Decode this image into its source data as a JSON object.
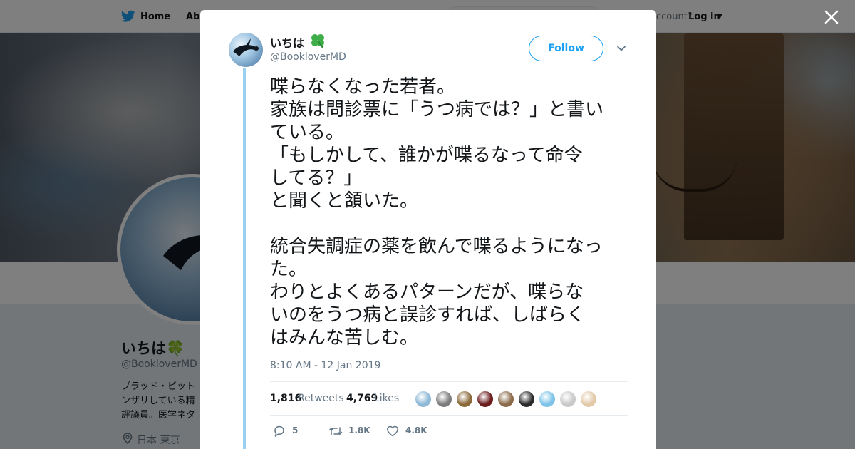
{
  "nav": {
    "home_label": "Home",
    "about_label": "Abo",
    "account_prompt": "ccount?",
    "login_label": "Log in"
  },
  "profile": {
    "name": "いちは🍀",
    "handle": "@BookloverMD",
    "bio": "ブラッド・ピット\nンザリしている精\n評議員。医学ネタ",
    "location": "日本 東京"
  },
  "tweet": {
    "author_name": "いちは",
    "author_emoji": "🍀",
    "author_handle": "@BookloverMD",
    "follow_label": "Follow",
    "text": "喋らなくなった若者。\n家族は問診票に「うつ病では？」と書い\nている。\n「もしかして、誰かが喋るなって命令\nしてる？」\nと聞くと頷いた。\n\n統合失調症の薬を飲んで喋るようになっ\nた。\nわりとよくあるパターンだが、喋らな\nいのをうつ病と誤診すれば、しばらく\nはみんな苦しむ。",
    "timestamp": "8:10 AM - 12 Jan 2019",
    "retweets_count": "1,816",
    "retweets_label": "Retweets",
    "likes_count": "4,769",
    "likes_label": "Likes",
    "replies_short": "5",
    "retweets_short": "1.8K",
    "likes_short": "4.8K",
    "liker_avatar_colors": [
      "#8fb9d6",
      "#7d7d7d",
      "#8a6a3a",
      "#6b1d1d",
      "#8c6b4a",
      "#2b2b2b",
      "#7fc4e8",
      "#c9c9c9",
      "#e3c9a8"
    ]
  },
  "colors": {
    "brand_blue": "#1da1f2",
    "thread_line": "#9ad0ef",
    "text_primary": "#14171a",
    "text_secondary": "#657786"
  },
  "icons": [
    "twitter-bird-icon",
    "close-icon",
    "chevron-down-icon",
    "reply-icon",
    "retweet-icon",
    "like-icon",
    "location-pin-icon",
    "four-leaf-clover-icon"
  ]
}
